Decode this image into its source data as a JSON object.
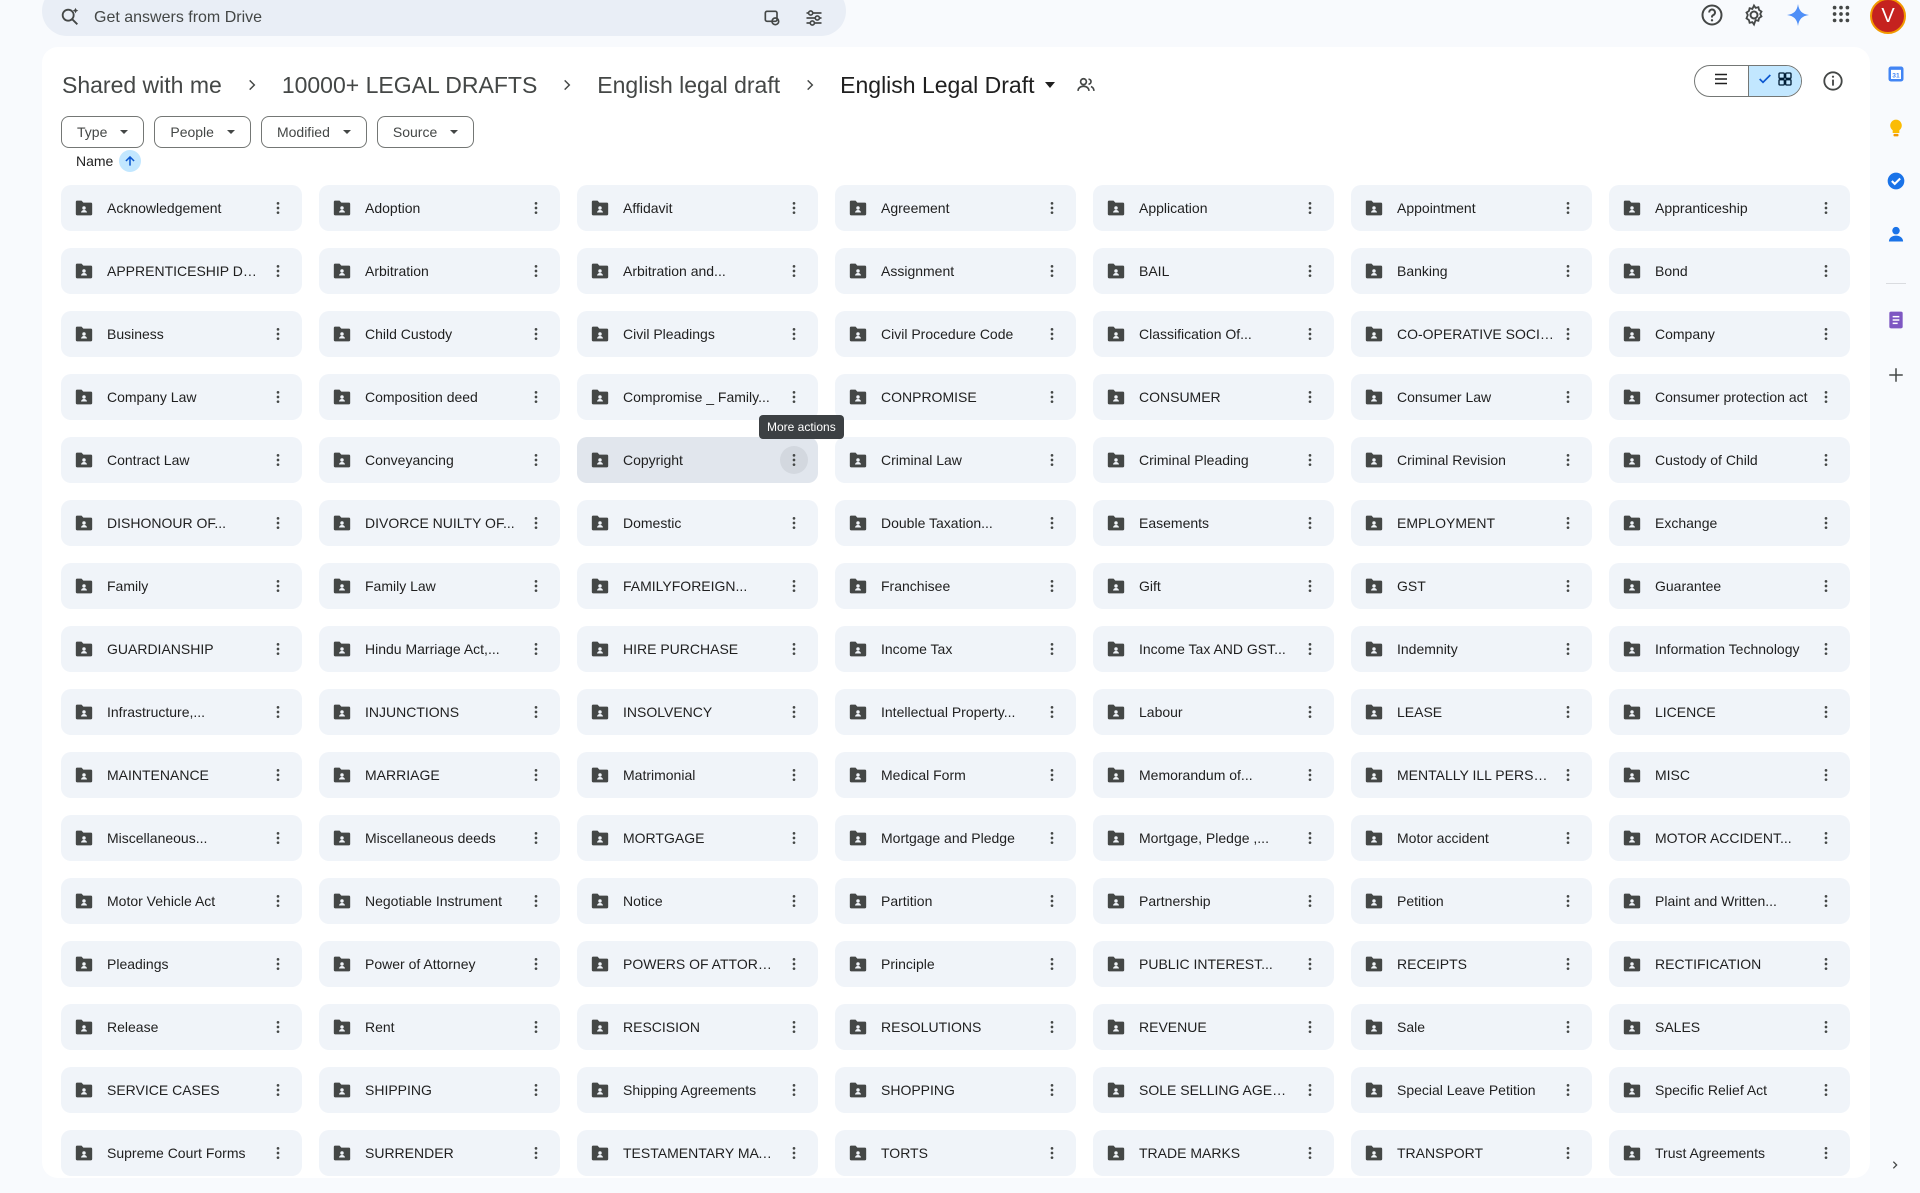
{
  "search": {
    "placeholder": "Get answers from Drive"
  },
  "user": {
    "avatar_letter": "V"
  },
  "breadcrumb": {
    "items": [
      "Shared with me",
      "10000+ LEGAL DRAFTS",
      "English legal draft"
    ],
    "current": "English Legal Draft"
  },
  "filters": [
    "Type",
    "People",
    "Modified",
    "Source"
  ],
  "sort": {
    "label": "Name"
  },
  "tooltip": "More actions",
  "folders": [
    "Acknowledgement",
    "Adoption",
    "Affidavit",
    "Agreement",
    "Application",
    "Appointment",
    "Appranticeship",
    "APPRENTICESHIP DEED",
    "Arbitration",
    "Arbitration and...",
    "Assignment",
    "BAIL",
    "Banking",
    "Bond",
    "Business",
    "Child Custody",
    "Civil Pleadings",
    "Civil Procedure Code",
    "Classification Of...",
    "CO-OPERATIVE SOCIETY",
    "Company",
    "Company Law",
    "Composition deed",
    "Compromise _ Family...",
    "CONPROMISE",
    "CONSUMER",
    "Consumer Law",
    "Consumer protection act",
    "Contract Law",
    "Conveyancing",
    "Copyright",
    "Criminal Law",
    "Criminal Pleading",
    "Criminal Revision",
    "Custody of Child",
    "DISHONOUR OF...",
    "DIVORCE NUILTY OF...",
    "Domestic",
    "Double Taxation...",
    "Easements",
    "EMPLOYMENT",
    "Exchange",
    "Family",
    "Family Law",
    "FAMILYFOREIGN...",
    "Franchisee",
    "Gift",
    "GST",
    "Guarantee",
    "GUARDIANSHIP",
    "Hindu Marriage Act,...",
    "HIRE PURCHASE",
    "Income Tax",
    "Income Tax AND GST...",
    "Indemnity",
    "Information Technology",
    "Infrastructure,...",
    "INJUNCTIONS",
    "INSOLVENCY",
    "Intellectual Property...",
    "Labour",
    "LEASE",
    "LICENCE",
    "MAINTENANCE",
    "MARRIAGE",
    "Matrimonial",
    "Medical Form",
    "Memorandum of...",
    "MENTALLY ILL PERSONS",
    "MISC",
    "Miscellaneous...",
    "Miscellaneous deeds",
    "MORTGAGE",
    "Mortgage and Pledge",
    "Mortgage, Pledge ,...",
    "Motor accident",
    "MOTOR ACCIDENT...",
    "Motor Vehicle Act",
    "Negotiable Instrument",
    "Notice",
    "Partition",
    "Partnership",
    "Petition",
    "Plaint and Written...",
    "Pleadings",
    "Power of Attorney",
    "POWERS OF ATTORNEY",
    "Principle",
    "PUBLIC INTEREST...",
    "RECEIPTS",
    "RECTIFICATION",
    "Release",
    "Rent",
    "RESCISION",
    "RESOLUTIONS",
    "REVENUE",
    "Sale",
    "SALES",
    "SERVICE CASES",
    "SHIPPING",
    "Shipping Agreements",
    "SHOPPING",
    "SOLE SELLING AGENCY",
    "Special Leave Petition",
    "Specific Relief Act",
    "Supreme Court Forms",
    "SURRENDER",
    "TESTAMENTARY MATTER",
    "TORTS",
    "TRADE MARKS",
    "TRANSPORT",
    "Trust Agreements"
  ],
  "hovered_folder": "Copyright",
  "colors": {
    "accent": "#0b57d0",
    "selected": "#c2e7ff",
    "card_bg": "#f0f4f9",
    "avatar": "#c5221f"
  }
}
